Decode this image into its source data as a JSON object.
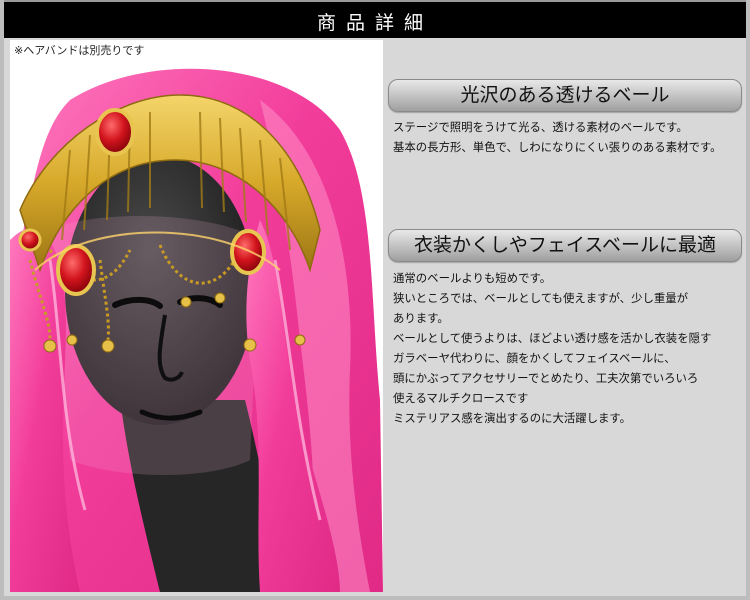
{
  "header": {
    "title": "商品詳細"
  },
  "photo": {
    "note": "※ヘアバンドは別売りです"
  },
  "sections": [
    {
      "heading": "光沢のある透けるベール",
      "lines": [
        "ステージで照明をうけて光る、透ける素材のベールです。",
        "基本の長方形、単色で、しわになりにくい張りのある素材です。"
      ]
    },
    {
      "heading": "衣装かくしやフェイスベールに最適",
      "lines": [
        "通常のベールよりも短めです。",
        "狭いところでは、ベールとしても使えますが、少し重量が",
        "あります。",
        "ベールとして使うよりは、ほどよい透け感を活かし衣装を隠す",
        "ガラベーヤ代わりに、顔をかくしてフェイスベールに、",
        "頭にかぶってアクセサリーでとめたり、工夫次第でいろいろ",
        "使えるマルチクロースです",
        "ミステリアス感を演出するのに大活躍します。"
      ]
    }
  ],
  "colors": {
    "veil_pink": "#f23c9a",
    "gold": "#d7a92a",
    "jewel_red": "#d2141d",
    "mannequin": "#2e2e2e"
  }
}
